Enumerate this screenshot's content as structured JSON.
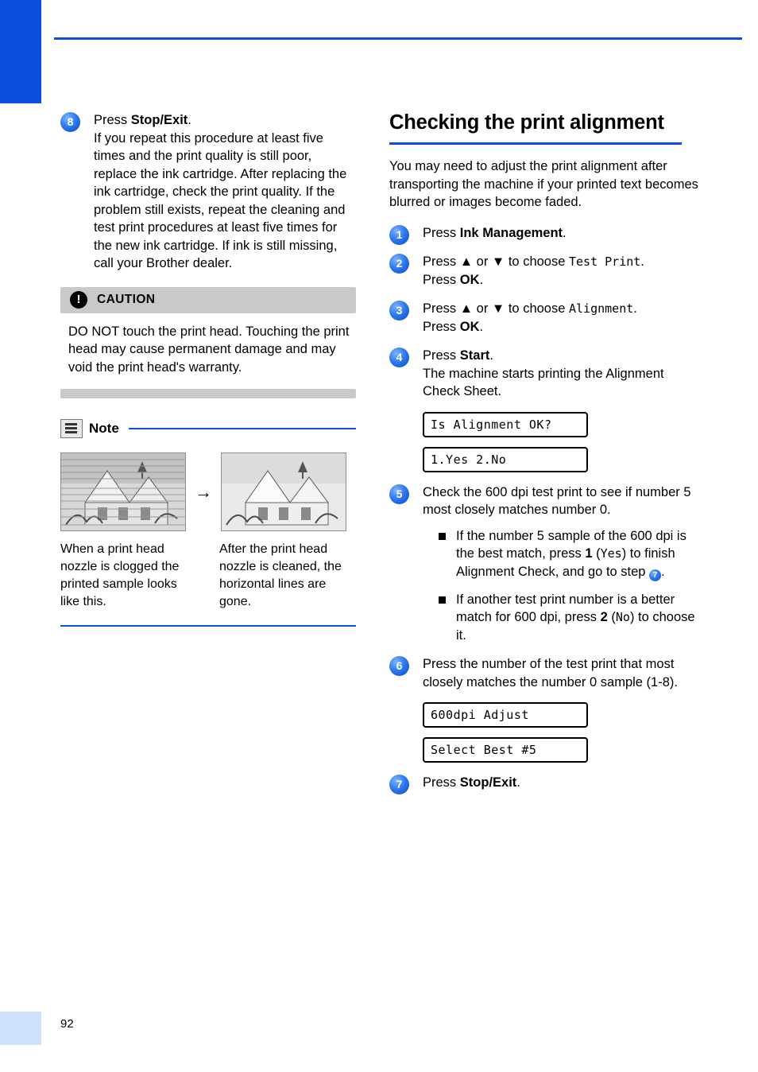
{
  "page": {
    "number": "92"
  },
  "left": {
    "step8": {
      "num": "8",
      "line1_pre": "Press ",
      "line1_bold": "Stop/Exit",
      "line1_post": ".",
      "body": "If you repeat this procedure at least five times and the print quality is still poor, replace the ink cartridge. After replacing the ink cartridge, check the print quality. If the problem still exists, repeat the cleaning and test print procedures at least five times for the new ink cartridge. If ink is still missing, call your Brother dealer."
    },
    "caution": {
      "icon_char": "!",
      "title": "CAUTION",
      "text": "DO NOT touch the print head. Touching the print head may cause permanent damage and may void the print head's warranty."
    },
    "note": {
      "title": "Note",
      "icon": "note-pencil-icon",
      "arrow": "→",
      "image_left_alt": "clogged-nozzle-sample-image",
      "image_right_alt": "cleaned-nozzle-sample-image",
      "caption_left": "When a print head nozzle is clogged the printed sample looks like this.",
      "caption_right": "After the print head nozzle is cleaned, the horizontal lines are gone."
    }
  },
  "right": {
    "title": "Checking the print alignment",
    "intro": "You may need to adjust the print alignment after transporting the machine if your printed text becomes blurred or images become faded.",
    "steps": [
      {
        "num": "1",
        "pre": "Press ",
        "bold": "Ink Management",
        "post": "."
      },
      {
        "num": "2",
        "pre": "Press ▲ or ▼ to choose ",
        "mono": "Test Print",
        "post": ".",
        "line2_pre": "Press ",
        "line2_bold": "OK",
        "line2_post": "."
      },
      {
        "num": "3",
        "pre": "Press ▲ or ▼ to choose ",
        "mono": "Alignment",
        "post": ".",
        "line2_pre": "Press ",
        "line2_bold": "OK",
        "line2_post": "."
      },
      {
        "num": "4",
        "pre": "Press ",
        "bold": "Start",
        "post": ".",
        "line2": "The machine starts printing the Alignment Check Sheet."
      },
      {
        "num": "5",
        "text": "Check the 600 dpi test print to see if number 5 most closely matches number 0."
      },
      {
        "num": "6",
        "text": "Press the number of the test print that most closely matches the number 0 sample (1-8)."
      },
      {
        "num": "7",
        "pre": "Press ",
        "bold": "Stop/Exit",
        "post": "."
      }
    ],
    "lcd": {
      "alignment_ok": "Is Alignment OK?",
      "yes_no": "1.Yes 2.No",
      "adjust": "600dpi Adjust",
      "select_best": "Select Best #5"
    },
    "bullets": [
      {
        "p1": "If the number 5 sample of the 600 dpi is the best match, press ",
        "b1": "1",
        "p2": " (",
        "m1": "Yes",
        "p3": ") to finish Alignment Check, and go to step ",
        "badge": "7",
        "p4": "."
      },
      {
        "p1": "If another test print number is a better match for 600 dpi, press ",
        "b1": "2",
        "p2": " (",
        "m1": "No",
        "p3": ") to choose it.",
        "badge": "",
        "p4": ""
      }
    ]
  }
}
